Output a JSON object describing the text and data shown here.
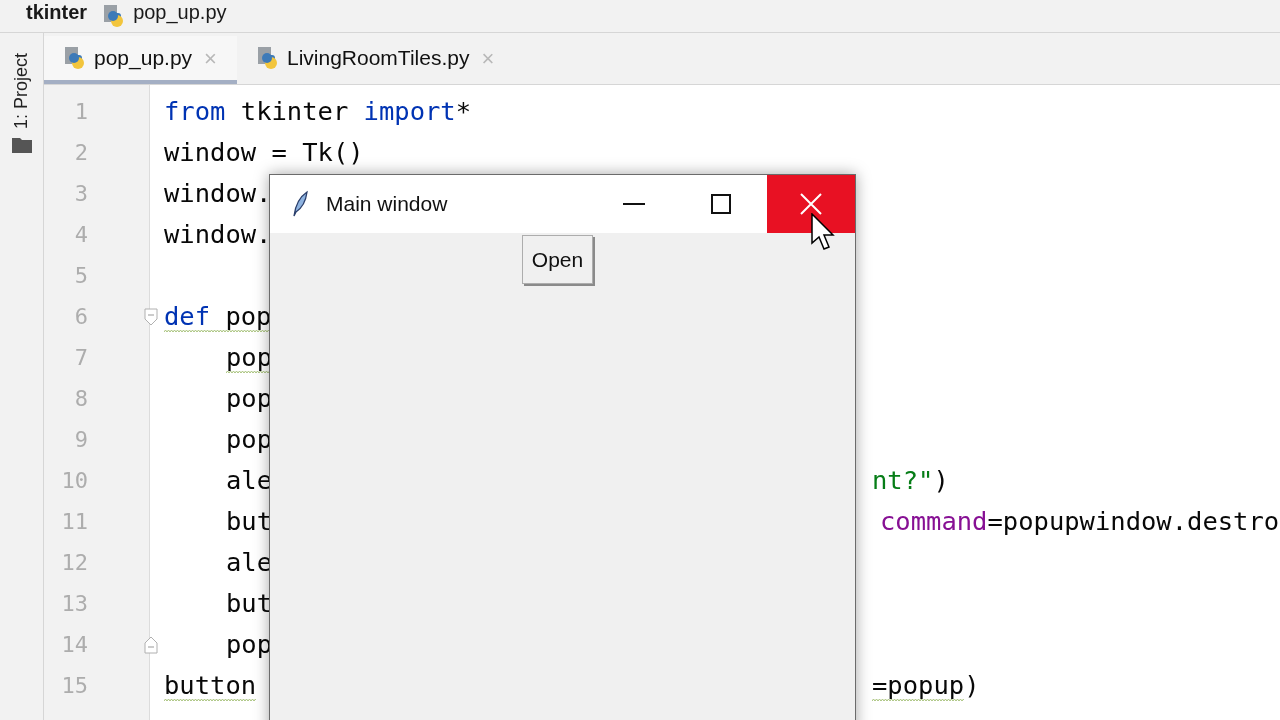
{
  "breadcrumb": [
    {
      "label": "tkinter",
      "kind": "folder"
    },
    {
      "label": "pop_up.py",
      "kind": "file"
    }
  ],
  "side_tool": {
    "label": "1: Project"
  },
  "tabs": [
    {
      "label": "pop_up.py",
      "selected": true,
      "close": "×"
    },
    {
      "label": "LivingRoomTiles.py",
      "selected": false,
      "close": "×"
    }
  ],
  "code": [
    {
      "number": "1",
      "left": [
        {
          "text": "from",
          "kind": "keyword",
          "warning": false
        },
        {
          "text": " tkinter ",
          "kind": "plain",
          "warning": false
        },
        {
          "text": "import",
          "kind": "keyword",
          "warning": false
        },
        {
          "text": "*",
          "kind": "plain",
          "warning": false
        }
      ]
    },
    {
      "number": "2",
      "left": [
        {
          "text": "window = Tk()",
          "kind": "plain",
          "warning": false
        }
      ]
    },
    {
      "number": "3",
      "left": [
        {
          "text": "window.",
          "kind": "plain",
          "warning": false
        }
      ]
    },
    {
      "number": "4",
      "left": [
        {
          "text": "window.",
          "kind": "plain",
          "warning": false
        }
      ]
    },
    {
      "number": "5"
    },
    {
      "number": "6",
      "kind": "fold_start",
      "left": [
        {
          "text": "def",
          "kind": "keyword",
          "warning": true
        },
        {
          "text": " pop",
          "kind": "plain",
          "warning": true
        }
      ],
      "children": [
        {
          "number": "7",
          "left": [
            {
              "text": "pop",
              "kind": "plain",
              "warning": true
            }
          ]
        },
        {
          "number": "8",
          "left": [
            {
              "text": "pop",
              "kind": "plain",
              "warning": false
            }
          ]
        },
        {
          "number": "9",
          "left": [
            {
              "text": "pop",
              "kind": "plain",
              "warning": false
            }
          ]
        },
        {
          "number": "10",
          "left": [
            {
              "text": "ale",
              "kind": "plain",
              "warning": false
            }
          ],
          "right": [
            {
              "text": "nt?\"",
              "kind": "string",
              "warning": false
            },
            {
              "text": ")",
              "kind": "plain",
              "warning": false
            }
          ]
        },
        {
          "number": "11",
          "left": [
            {
              "text": "but",
              "kind": "plain",
              "warning": false
            }
          ],
          "right": [
            {
              "text": "command",
              "kind": "param",
              "warning": false
            },
            {
              "text": "=popupwindow.destro",
              "kind": "plain",
              "warning": false
            }
          ]
        },
        {
          "number": "12",
          "left": [
            {
              "text": "ale",
              "kind": "plain",
              "warning": false
            }
          ]
        },
        {
          "number": "13",
          "left": [
            {
              "text": "but",
              "kind": "plain",
              "warning": false
            }
          ]
        },
        {
          "number": "14",
          "kind": "fold_end",
          "left": [
            {
              "text": "pop",
              "kind": "plain",
              "warning": false
            }
          ]
        }
      ]
    },
    {
      "number": "15",
      "left": [
        {
          "text": "button",
          "kind": "plain",
          "warning": true
        }
      ],
      "right": [
        {
          "text": "=popup",
          "kind": "plain",
          "warning": true
        },
        {
          "text": ")",
          "kind": "plain",
          "warning": false
        }
      ]
    }
  ],
  "tk_window": {
    "title": "Main window",
    "close_hovered": true,
    "button": "Open"
  }
}
